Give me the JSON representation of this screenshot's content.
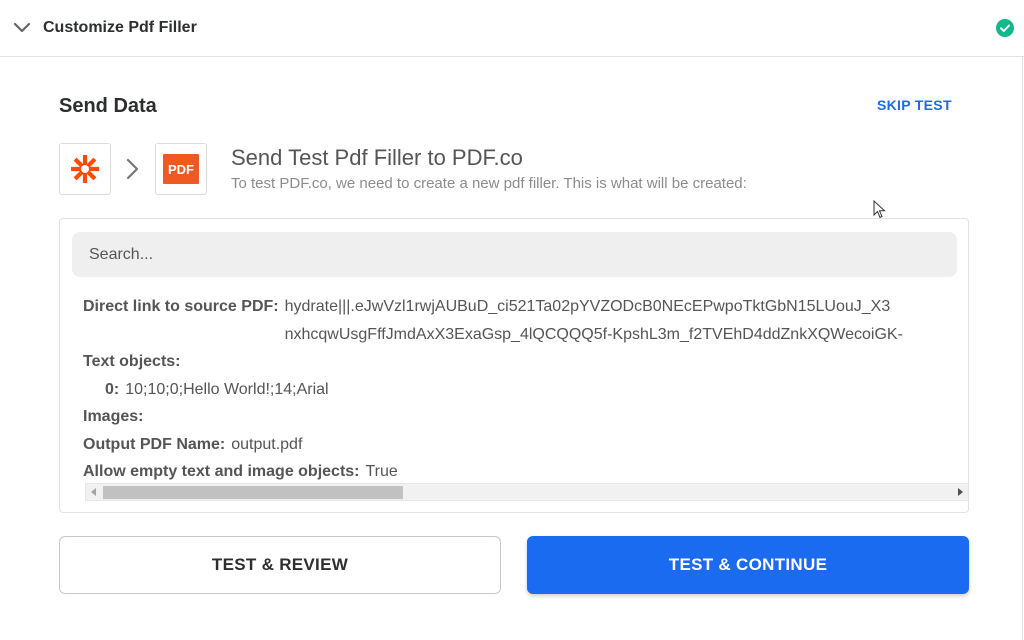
{
  "header": {
    "title": "Customize Pdf Filler",
    "collapse_icon": "chevron-down-icon",
    "status_icon": "check-circle-icon",
    "status_color": "#13b88a"
  },
  "section": {
    "title": "Send Data",
    "skip_label": "SKIP TEST"
  },
  "apps": {
    "source_icon": "zapier-logo",
    "target_logo_text": "PDF",
    "arrow_icon": "chevron-right-icon"
  },
  "send": {
    "title": "Send Test Pdf Filler to PDF.co",
    "subtitle": "To test PDF.co, we need to create a new pdf filler. This is what will be created:"
  },
  "search": {
    "placeholder": "Search..."
  },
  "fields": {
    "source_pdf_label": "Direct link to source PDF:",
    "source_pdf_line1": "hydrate|||.eJwVzl1rwjAUBuD_ci521Ta02pYVZODcB0NEcEPwpoTktGbN15LUouJ_X3",
    "source_pdf_line2": "nxhcqwUsgFffJmdAxX3ExaGsp_4lQCQQQ5f-KpshL3m_f2TVEhD4ddZnkXQWecoiGK-",
    "text_objects_label": "Text objects:",
    "text_object_index": "0:",
    "text_object_value": "10;10;0;Hello World!;14;Arial",
    "images_label": "Images:",
    "output_name_label": "Output PDF Name:",
    "output_name_value": "output.pdf",
    "allow_empty_label": "Allow empty text and image objects:",
    "allow_empty_value": "True"
  },
  "buttons": {
    "review_label": "TEST & REVIEW",
    "continue_label": "TEST & CONTINUE"
  },
  "colors": {
    "accent": "#1a6bf0",
    "pdf_brand": "#f05a22",
    "zapier_brand": "#ff4a00"
  }
}
